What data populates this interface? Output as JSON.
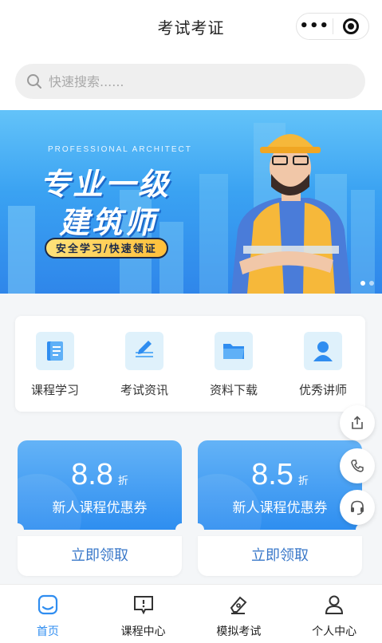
{
  "header": {
    "title": "考试考证",
    "more_label": "•••"
  },
  "search": {
    "placeholder": "快速搜索......"
  },
  "banner": {
    "subtitle": "PROFESSIONAL ARCHITECT",
    "line1": "专业一级",
    "line2": "建筑师",
    "tagline": "安全学习/快速领证",
    "dots": 2,
    "active_dot": 0
  },
  "nav": {
    "items": [
      {
        "label": "课程学习",
        "icon": "book-icon"
      },
      {
        "label": "考试资讯",
        "icon": "edit-note-icon"
      },
      {
        "label": "资料下载",
        "icon": "folder-icon"
      },
      {
        "label": "优秀讲师",
        "icon": "teacher-icon"
      }
    ]
  },
  "coupons": [
    {
      "discount": "8.8",
      "unit": "折",
      "desc": "新人课程优惠券",
      "button": "立即领取"
    },
    {
      "discount": "8.5",
      "unit": "折",
      "desc": "新人课程优惠券",
      "button": "立即领取"
    }
  ],
  "floating": [
    "share-icon",
    "phone-icon",
    "headset-icon"
  ],
  "tabbar": {
    "active": 0,
    "items": [
      {
        "label": "首页",
        "icon": "home-icon"
      },
      {
        "label": "课程中心",
        "icon": "course-icon"
      },
      {
        "label": "模拟考试",
        "icon": "pen-icon"
      },
      {
        "label": "个人中心",
        "icon": "user-icon"
      }
    ]
  },
  "colors": {
    "accent": "#2f8df0",
    "banner": "#3aa2f2",
    "tagline": "#ffc94a"
  }
}
